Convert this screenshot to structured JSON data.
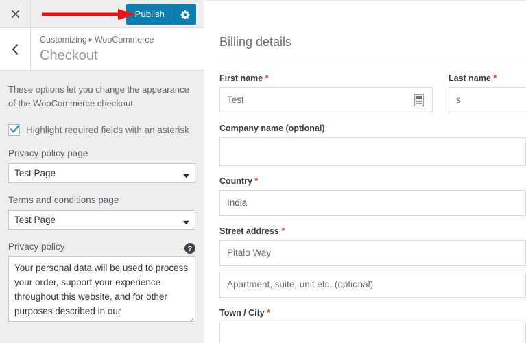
{
  "customizer": {
    "topbar": {
      "close_label": "Close",
      "close_icon": "close-icon",
      "publish_label": "Publish",
      "gear_icon": "gear-icon"
    },
    "annotation": {
      "type": "red-arrow",
      "color": "#ee1111",
      "points_to": "Publish"
    },
    "header": {
      "back_icon": "chevron-left-icon",
      "breadcrumb_root": "Customizing",
      "breadcrumb_separator": "▸",
      "breadcrumb_section": "WooCommerce",
      "panel_title": "Checkout"
    },
    "intro_text": "These options let you change the appearance of the WooCommerce checkout.",
    "highlight_required": {
      "label": "Highlight required fields with an asterisk",
      "checked": true
    },
    "privacy_policy_page": {
      "label": "Privacy policy page",
      "value": "Test Page"
    },
    "terms_page": {
      "label": "Terms and conditions page",
      "value": "Test Page"
    },
    "privacy_policy_text": {
      "label": "Privacy policy",
      "help_icon": "help-icon",
      "value": "Your personal data will be used to process your order, support your experience throughout this website, and for other purposes described in our [privacy_policy]."
    },
    "colors": {
      "publish_blue": "#0c7fb0",
      "sidebar_bg": "#eeeeee",
      "checkbox_blue": "#1e8cbe",
      "arrow_red": "#ee1111"
    }
  },
  "preview": {
    "section_title": "Billing details",
    "fields": {
      "first_name": {
        "label": "First name",
        "required": true,
        "value": "Test",
        "placeholder": "",
        "autofill_icon": "autofill-icon"
      },
      "last_name": {
        "label": "Last name",
        "required": true,
        "value": "s",
        "placeholder": ""
      },
      "company_name": {
        "label": "Company name (optional)",
        "required": false,
        "value": "",
        "placeholder": ""
      },
      "country": {
        "label": "Country",
        "required": true,
        "value": "India",
        "placeholder": ""
      },
      "street_address": {
        "label": "Street address",
        "required": true,
        "value": "Pitalo Way",
        "placeholder": ""
      },
      "address_line_2": {
        "label": "",
        "required": false,
        "value": "",
        "placeholder": "Apartment, suite, unit etc. (optional)"
      },
      "town_city": {
        "label": "Town / City",
        "required": true,
        "value": "",
        "placeholder": ""
      }
    },
    "required_marker": "*"
  }
}
